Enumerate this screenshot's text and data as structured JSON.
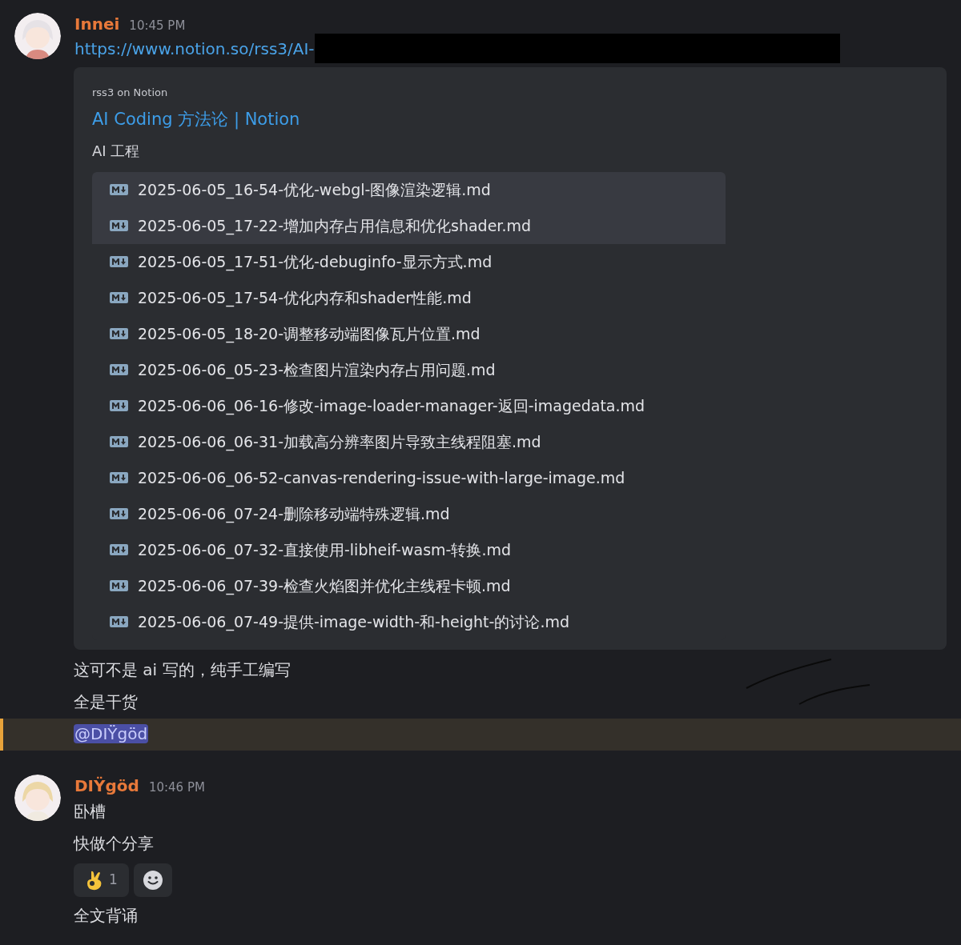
{
  "messages": [
    {
      "author": "Innei",
      "time": "10:45 PM",
      "link": "https://www.notion.so/rss3/AI-",
      "embed": {
        "provider": "rss3 on Notion",
        "title": "AI Coding 方法论 | Notion",
        "description": "AI 工程",
        "files": [
          {
            "name": "2025-06-05_16-54-优化-webgl-图像渲染逻辑.md",
            "selected": true
          },
          {
            "name": "2025-06-05_17-22-增加内存占用信息和优化shader.md",
            "selected": true
          },
          {
            "name": "2025-06-05_17-51-优化-debuginfo-显示方式.md",
            "selected": false
          },
          {
            "name": "2025-06-05_17-54-优化内存和shader性能.md",
            "selected": false
          },
          {
            "name": "2025-06-05_18-20-调整移动端图像瓦片位置.md",
            "selected": false
          },
          {
            "name": "2025-06-06_05-23-检查图片渲染内存占用问题.md",
            "selected": false
          },
          {
            "name": "2025-06-06_06-16-修改-image-loader-manager-返回-imagedata.md",
            "selected": false
          },
          {
            "name": "2025-06-06_06-31-加载高分辨率图片导致主线程阻塞.md",
            "selected": false
          },
          {
            "name": "2025-06-06_06-52-canvas-rendering-issue-with-large-image.md",
            "selected": false
          },
          {
            "name": "2025-06-06_07-24-删除移动端特殊逻辑.md",
            "selected": false
          },
          {
            "name": "2025-06-06_07-32-直接使用-libheif-wasm-转换.md",
            "selected": false
          },
          {
            "name": "2025-06-06_07-39-检查火焰图并优化主线程卡顿.md",
            "selected": false
          },
          {
            "name": "2025-06-06_07-49-提供-image-width-和-height-的讨论.md",
            "selected": false
          }
        ]
      },
      "content": [
        {
          "kind": "text",
          "text": "这可不是 ai 写的，纯手工编写"
        },
        {
          "kind": "text",
          "text": "全是干货"
        },
        {
          "kind": "mention",
          "text": "@DIŸgöd"
        }
      ]
    },
    {
      "author": "DIŸgöd",
      "time": "10:46 PM",
      "content": [
        {
          "kind": "text",
          "text": "卧槽"
        },
        {
          "kind": "text",
          "text": "快做个分享"
        },
        {
          "kind": "reactions",
          "reactions": [
            {
              "count": "1"
            }
          ]
        },
        {
          "kind": "text",
          "text": "全文背诵"
        }
      ]
    }
  ]
}
